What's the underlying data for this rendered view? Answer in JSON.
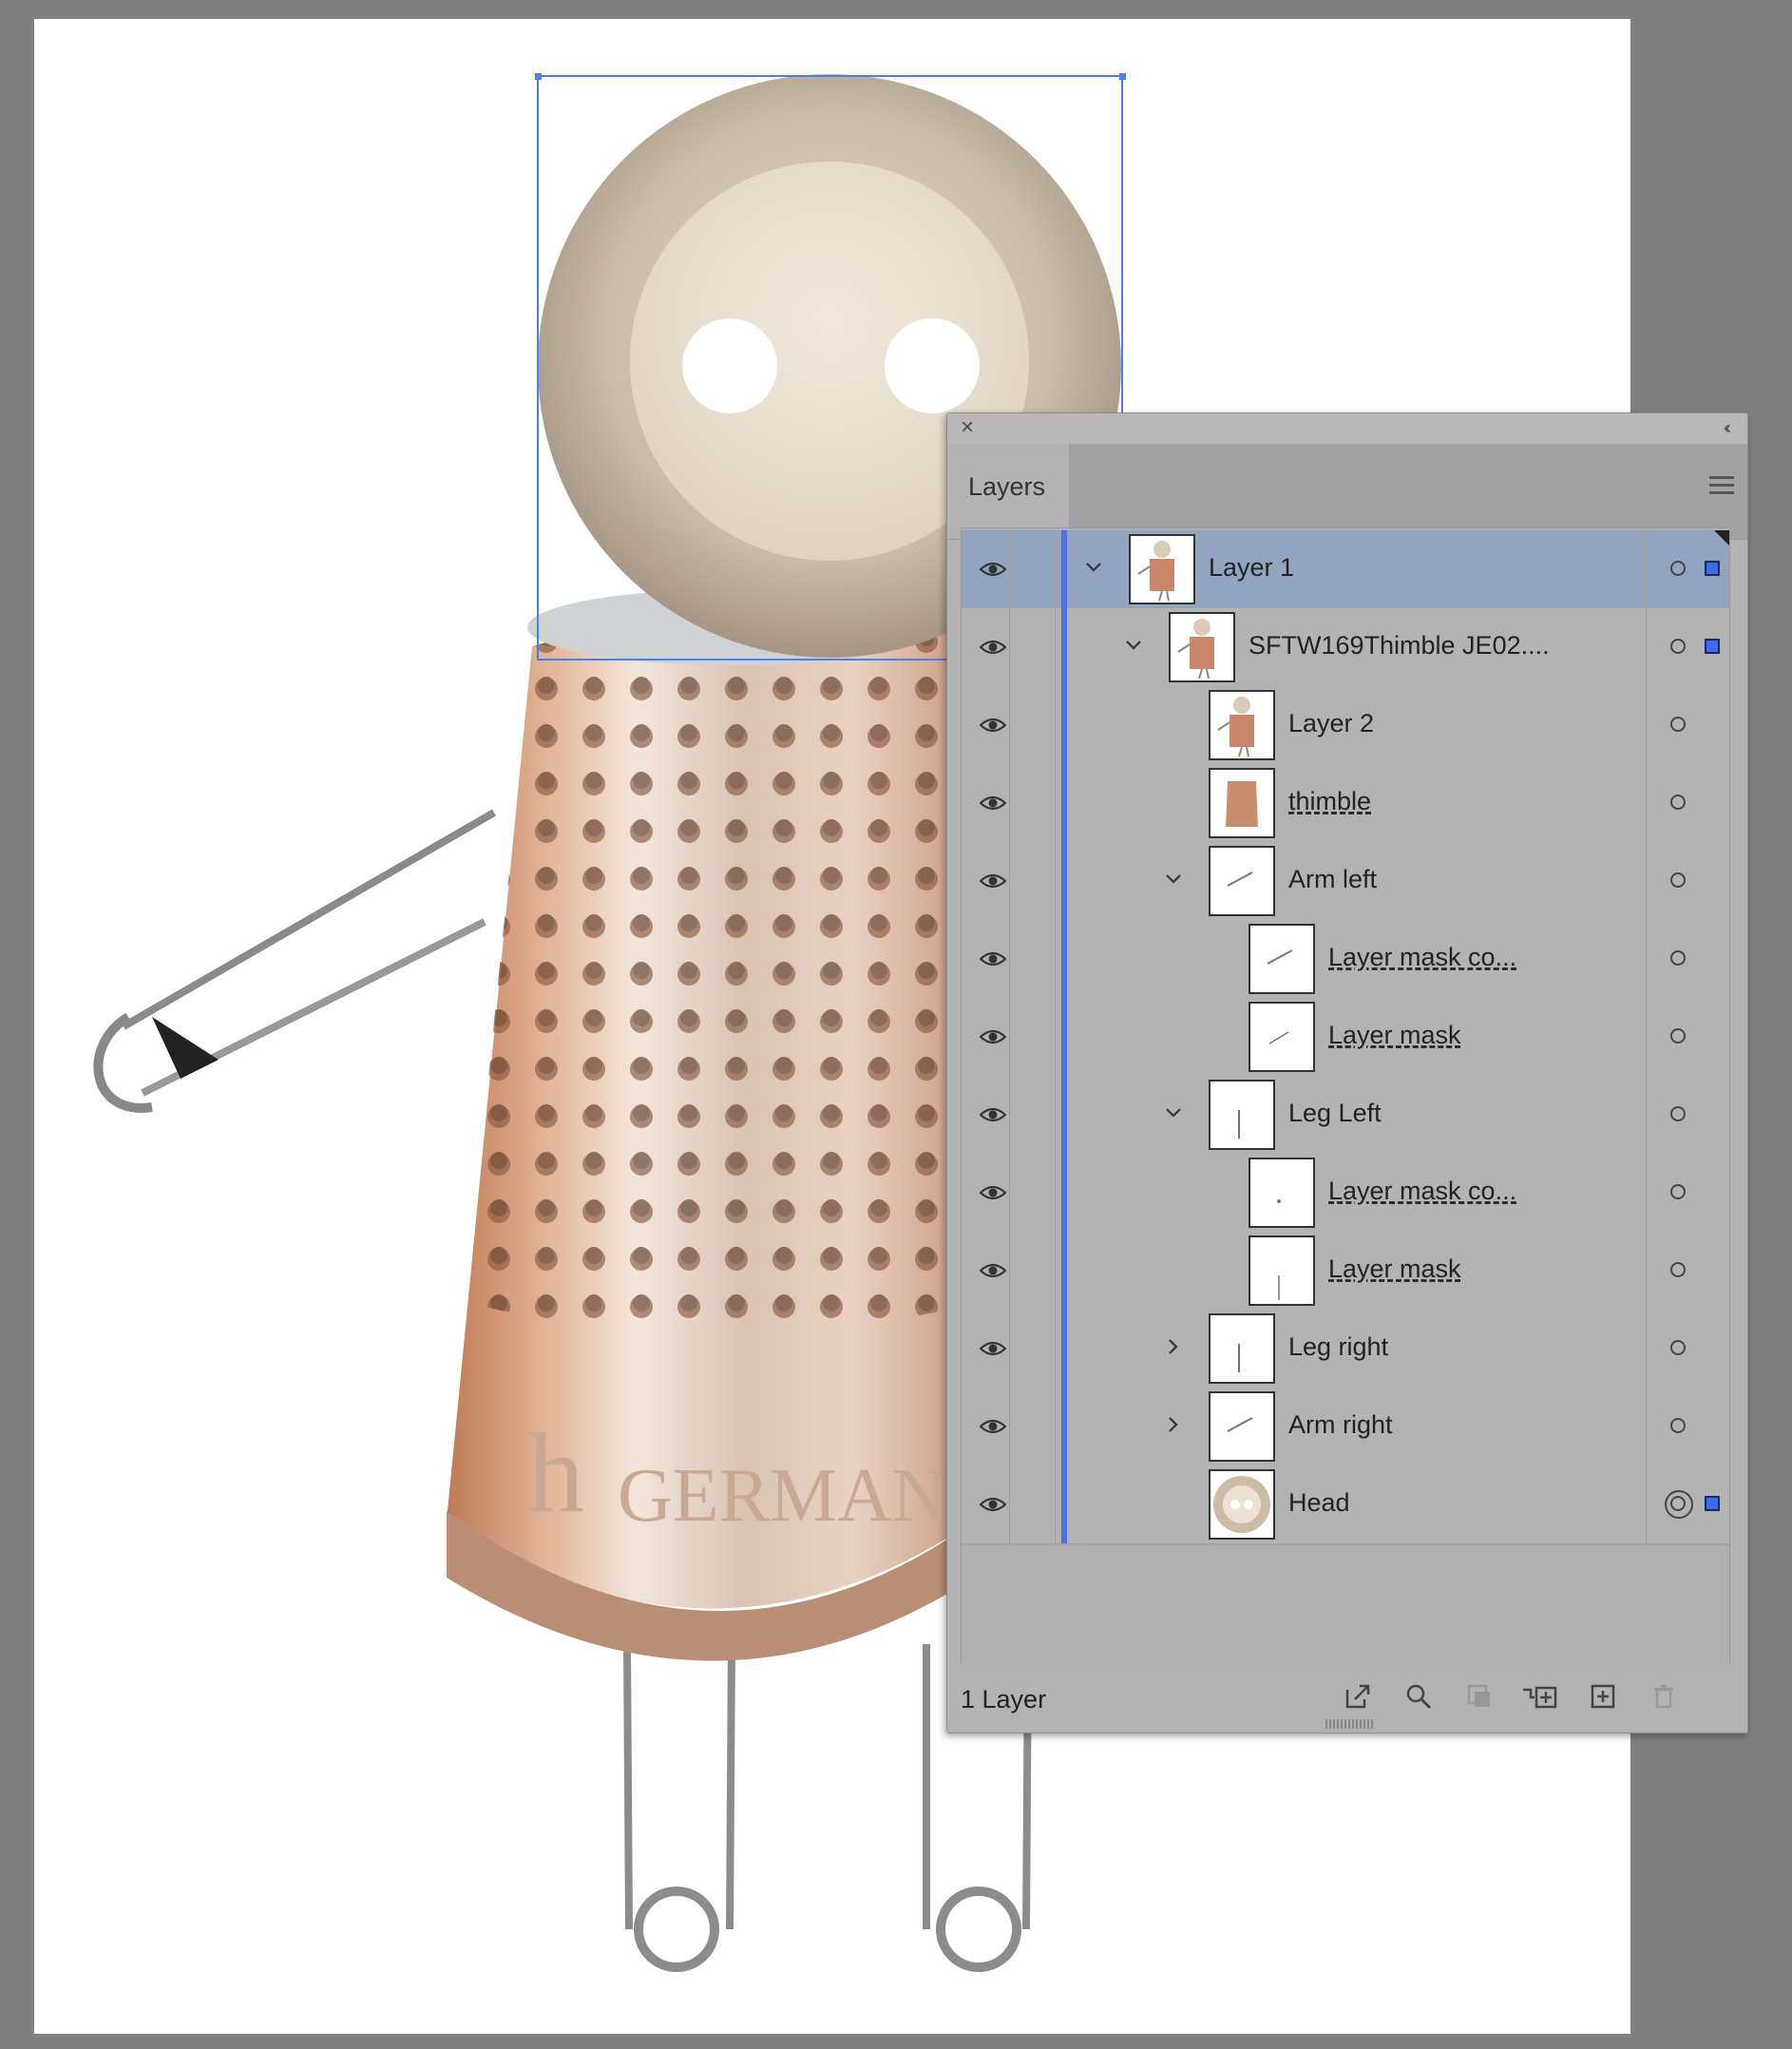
{
  "panel": {
    "tab_label": "Layers",
    "footer_count": "1 Layer",
    "accent_color": "#4d6fe0",
    "selected_row_color": "#93a4c0"
  },
  "layers": [
    {
      "name": "Layer 1",
      "depth": 0,
      "expanded": true,
      "selected": true,
      "has_selection": true,
      "underlined": false,
      "thumb": "figure"
    },
    {
      "name": "SFTW169Thimble JE02....",
      "depth": 1,
      "expanded": true,
      "selected": false,
      "has_selection": true,
      "underlined": false,
      "thumb": "figure"
    },
    {
      "name": "Layer 2",
      "depth": 2,
      "expanded": null,
      "selected": false,
      "has_selection": false,
      "underlined": false,
      "thumb": "figure"
    },
    {
      "name": "thimble",
      "depth": 2,
      "expanded": null,
      "selected": false,
      "has_selection": false,
      "underlined": true,
      "thumb": "thimble"
    },
    {
      "name": "Arm left",
      "depth": 2,
      "expanded": true,
      "selected": false,
      "has_selection": false,
      "underlined": false,
      "thumb": "pin"
    },
    {
      "name": "Layer mask co...",
      "depth": 3,
      "expanded": null,
      "selected": false,
      "has_selection": false,
      "underlined": true,
      "thumb": "pin"
    },
    {
      "name": "Layer mask",
      "depth": 3,
      "expanded": null,
      "selected": false,
      "has_selection": false,
      "underlined": true,
      "thumb": "line"
    },
    {
      "name": "Leg Left",
      "depth": 2,
      "expanded": true,
      "selected": false,
      "has_selection": false,
      "underlined": false,
      "thumb": "legpin"
    },
    {
      "name": "Layer mask co...",
      "depth": 3,
      "expanded": null,
      "selected": false,
      "has_selection": false,
      "underlined": true,
      "thumb": "dot"
    },
    {
      "name": "Layer mask",
      "depth": 3,
      "expanded": null,
      "selected": false,
      "has_selection": false,
      "underlined": true,
      "thumb": "vline"
    },
    {
      "name": "Leg right",
      "depth": 2,
      "expanded": false,
      "selected": false,
      "has_selection": false,
      "underlined": false,
      "thumb": "legpin"
    },
    {
      "name": "Arm right",
      "depth": 2,
      "expanded": false,
      "selected": false,
      "has_selection": false,
      "underlined": false,
      "thumb": "pin"
    },
    {
      "name": "Head",
      "depth": 2,
      "expanded": null,
      "selected": false,
      "has_selection": true,
      "underlined": false,
      "active_target": true,
      "thumb": "button"
    }
  ],
  "footer_buttons": [
    "export-for-screens-icon",
    "locate-object-icon",
    "make-clipping-mask-icon",
    "create-sublayer-icon",
    "create-new-layer-icon",
    "delete-icon"
  ]
}
